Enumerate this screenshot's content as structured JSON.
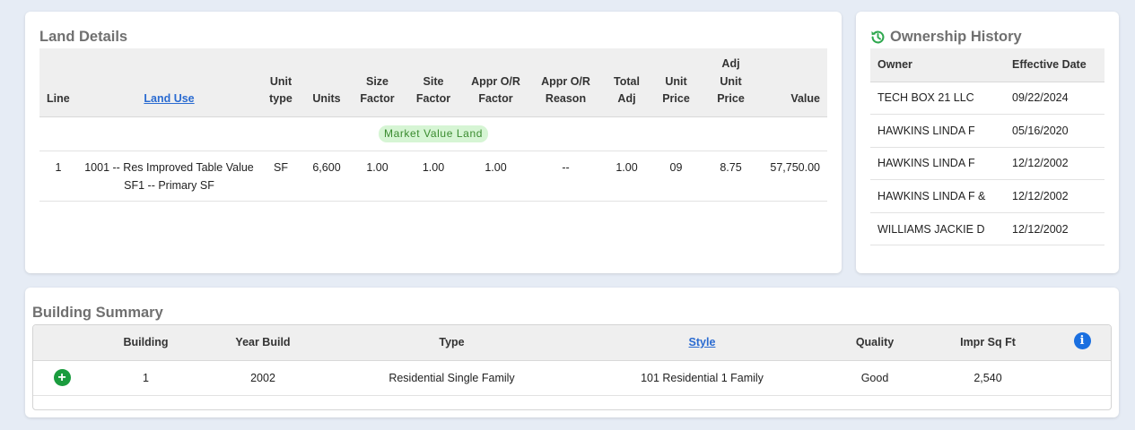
{
  "colors": {
    "background": "#e6ecf5",
    "card": "#ffffff",
    "header_row": "#efefef",
    "title_text": "#707070",
    "link": "#2a6bd1",
    "badge_bg": "#d6f5d4",
    "badge_text": "#3a8b2f",
    "history_icon": "#2fa84f",
    "add_button": "#1a9c3e",
    "info_button": "#1a6fe0"
  },
  "land": {
    "title": "Land Details",
    "headers": {
      "line": "Line",
      "land_use": "Land Use",
      "unit_type": [
        "Unit",
        "type"
      ],
      "units": "Units",
      "size_factor": [
        "Size",
        "Factor"
      ],
      "site_factor": [
        "Site",
        "Factor"
      ],
      "appr_factor": [
        "Appr O/R",
        "Factor"
      ],
      "appr_reason": [
        "Appr O/R",
        "Reason"
      ],
      "total_adj": [
        "Total",
        "Adj"
      ],
      "unit_price": [
        "Unit",
        "Price"
      ],
      "adj_unit_price": [
        "Adj",
        "Unit",
        "Price"
      ],
      "value": "Value"
    },
    "group_label": "Market Value Land",
    "rows": [
      {
        "line": "1",
        "land_use_line1": "1001 -- Res Improved Table Value",
        "land_use_line2": "SF1 -- Primary SF",
        "unit_type": "SF",
        "units": "6,600",
        "size_factor": "1.00",
        "site_factor": "1.00",
        "appr_factor": "1.00",
        "appr_reason": "--",
        "total_adj": "1.00",
        "unit_price": "09",
        "adj_unit_price": "8.75",
        "value": "57,750.00"
      }
    ]
  },
  "ownership": {
    "title": "Ownership History",
    "icon": "history-icon",
    "headers": {
      "owner": "Owner",
      "effective_date": "Effective Date"
    },
    "rows": [
      {
        "owner": "TECH BOX 21 LLC",
        "date": "09/22/2024"
      },
      {
        "owner": "HAWKINS LINDA F",
        "date": "05/16/2020"
      },
      {
        "owner": "HAWKINS LINDA F",
        "date": "12/12/2002"
      },
      {
        "owner": "HAWKINS LINDA F &",
        "date": "12/12/2002"
      },
      {
        "owner": "WILLIAMS JACKIE D",
        "date": "12/12/2002"
      }
    ]
  },
  "building": {
    "title": "Building Summary",
    "headers": {
      "building": "Building",
      "year_build": "Year Build",
      "type": "Type",
      "style": "Style",
      "quality": "Quality",
      "impr_sq_ft": "Impr Sq Ft"
    },
    "info_icon": "info-icon",
    "add_icon": "plus-circle-icon",
    "rows": [
      {
        "building": "1",
        "year_build": "2002",
        "type": "Residential Single Family",
        "style": "101 Residential 1 Family",
        "quality": "Good",
        "impr_sq_ft": "2,540"
      }
    ]
  }
}
